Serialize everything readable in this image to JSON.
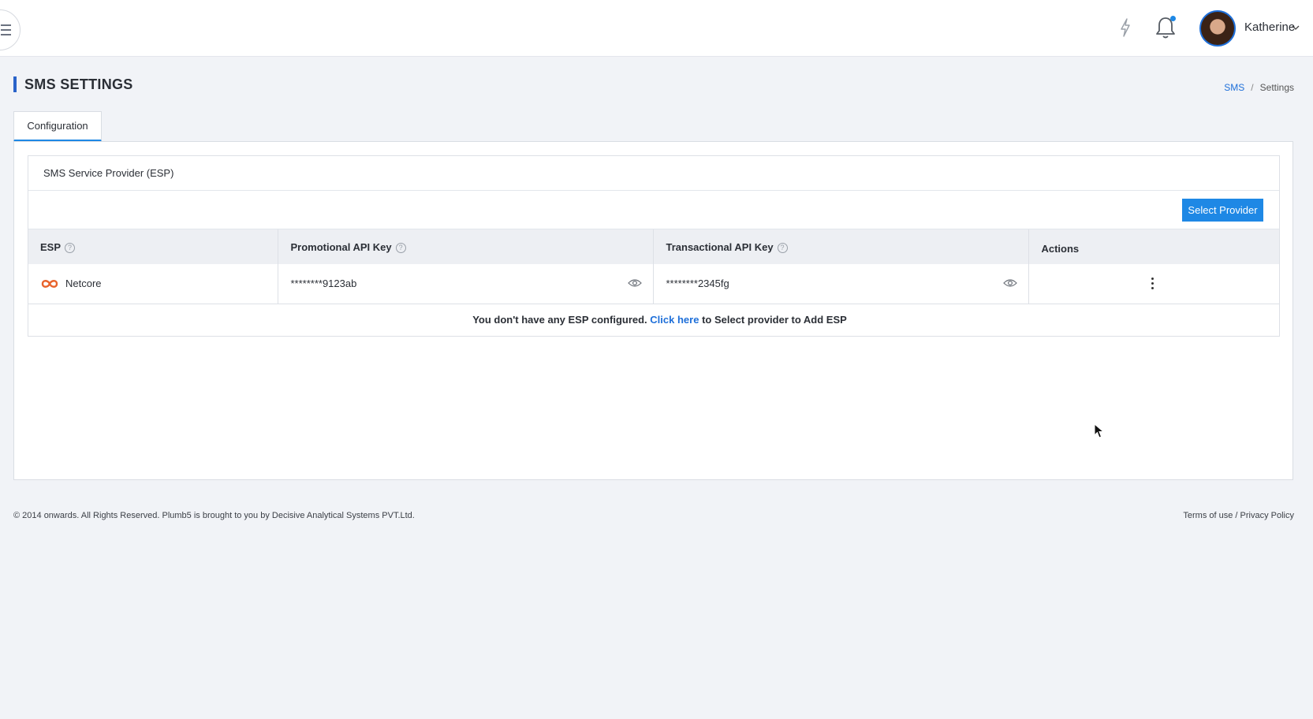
{
  "header": {
    "user_name": "Katherine",
    "icons": {
      "menu": "hamburger-menu-icon",
      "bolt": "lightning-bolt-icon",
      "bell": "notification-bell-icon",
      "chevron": "chevron-down-icon"
    },
    "accent_color": "#1e88e5"
  },
  "page": {
    "title": "SMS SETTINGS",
    "breadcrumb": [
      {
        "label": "SMS"
      },
      {
        "label": "Settings"
      }
    ]
  },
  "tabs": [
    {
      "label": "Configuration",
      "active": true
    }
  ],
  "card": {
    "title": "SMS Service Provider (ESP)",
    "select_button": "Select Provider",
    "table": {
      "columns": [
        "ESP",
        "Promotional API Key",
        "Transactional API Key",
        "Actions"
      ],
      "rows": [
        {
          "esp": "Netcore",
          "promotional_key": "********9123ab",
          "transactional_key": "********2345fg"
        }
      ],
      "empty_message": {
        "before": "You don't have any ESP configured.",
        "link": "Click here",
        "after": "to Select provider to Add ESP"
      }
    }
  },
  "footer": {
    "copyright": "© 2014 onwards. All Rights Reserved. Plumb5 is brought to you by Decisive Analytical Systems PVT.Ltd.",
    "links": "Terms of use / Privacy Policy"
  }
}
